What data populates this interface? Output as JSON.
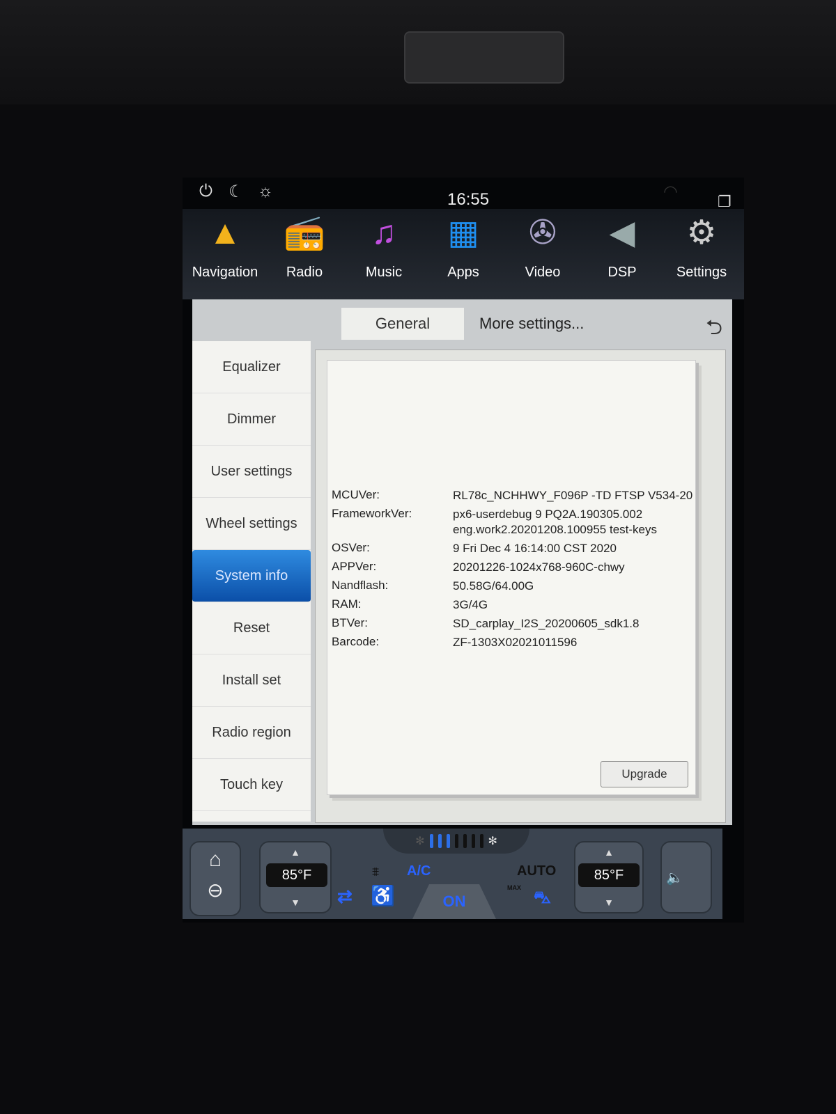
{
  "status_bar": {
    "time": "16:55"
  },
  "app_bar": [
    {
      "label": "Navigation",
      "icon": "navigation-arrow-icon",
      "glyph": "▲",
      "color": "#f2b21c"
    },
    {
      "label": "Radio",
      "icon": "radio-icon",
      "glyph": "📻",
      "color": "#e23a3a"
    },
    {
      "label": "Music",
      "icon": "music-note-icon",
      "glyph": "♫",
      "color": "#c24fe0"
    },
    {
      "label": "Apps",
      "icon": "apps-grid-icon",
      "glyph": "▦",
      "color": "#1f8ff0"
    },
    {
      "label": "Video",
      "icon": "video-reel-icon",
      "glyph": "✇",
      "color": "#a9a3c8"
    },
    {
      "label": "DSP",
      "icon": "speaker-icon",
      "glyph": "◀",
      "color": "#9aa"
    },
    {
      "label": "Settings",
      "icon": "gear-icon",
      "glyph": "⚙",
      "color": "#ccc"
    }
  ],
  "tabs": {
    "general": "General",
    "more": "More settings..."
  },
  "sidebar": [
    "Equalizer",
    "Dimmer",
    "User settings",
    "Wheel settings",
    "System info",
    "Reset",
    "Install set",
    "Radio region",
    "Touch key"
  ],
  "selected_sidebar": "System info",
  "system_info": [
    {
      "key": "MCUVer:",
      "value": "RL78c_NCHHWY_F096P  -TD FTSP V534-20"
    },
    {
      "key": "FrameworkVer:",
      "value": "px6-userdebug 9 PQ2A.190305.002 eng.work2.20201208.100955 test-keys"
    },
    {
      "key": "OSVer:",
      "value": "9  Fri Dec 4 16:14:00 CST 2020"
    },
    {
      "key": "APPVer:",
      "value": "20201226-1024x768-960C-chwy"
    },
    {
      "key": "Nandflash:",
      "value": "50.58G/64.00G"
    },
    {
      "key": "RAM:",
      "value": "3G/4G"
    },
    {
      "key": "BTVer:",
      "value": "SD_carplay_I2S_20200605_sdk1.8"
    },
    {
      "key": "Barcode:",
      "value": "ZF-1303X02021011596"
    }
  ],
  "upgrade_label": "Upgrade",
  "climate": {
    "left_temp": "85°F",
    "right_temp": "85°F",
    "ac": "A/C",
    "auto": "AUTO",
    "on": "ON",
    "max": "MAX",
    "fan_level": 3,
    "fan_max": 7
  }
}
